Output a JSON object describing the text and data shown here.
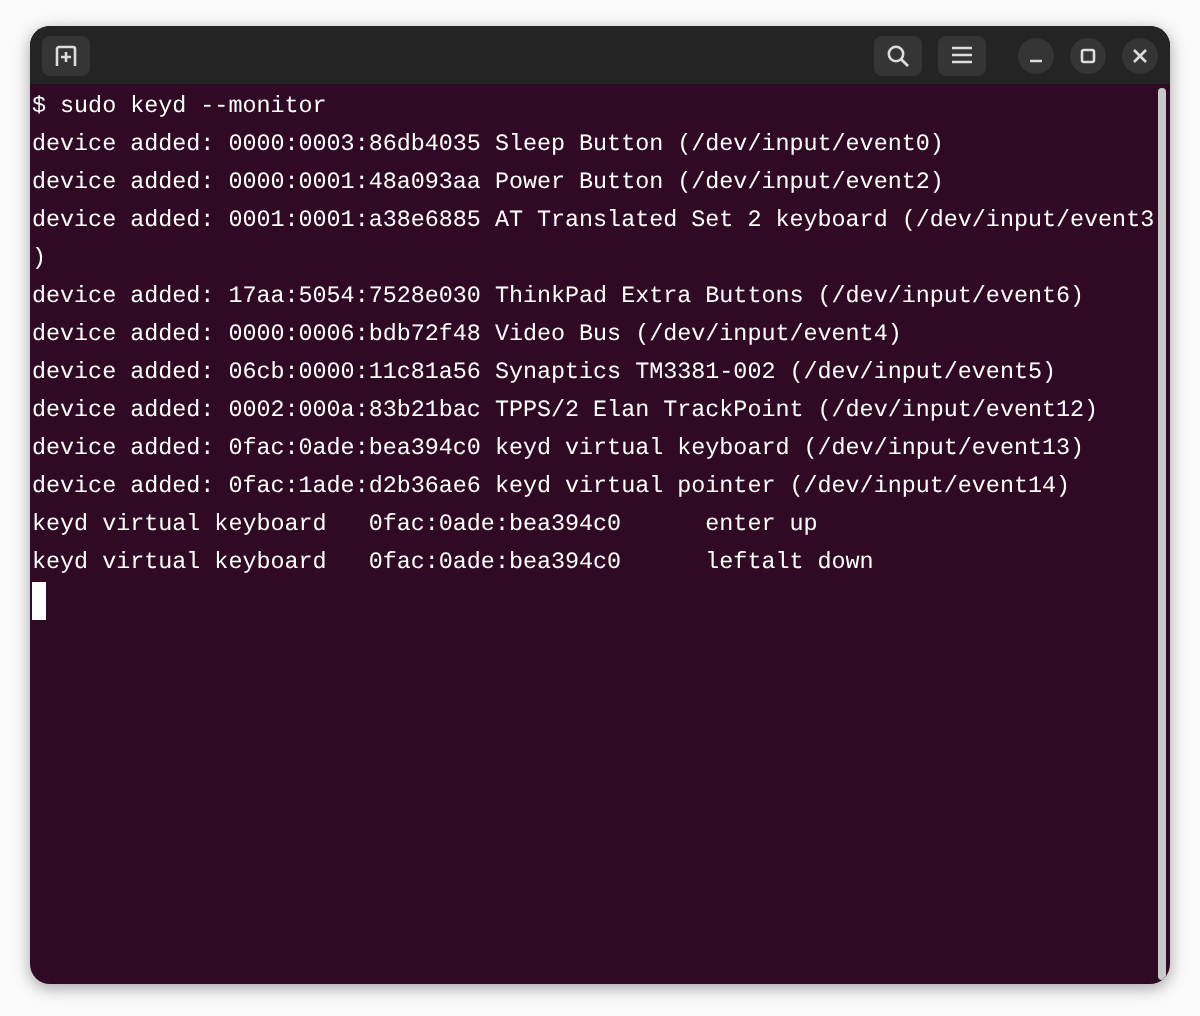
{
  "terminal": {
    "lines": [
      "$ sudo keyd --monitor",
      "device added: 0000:0003:86db4035 Sleep Button (/dev/input/event0)",
      "device added: 0000:0001:48a093aa Power Button (/dev/input/event2)",
      "device added: 0001:0001:a38e6885 AT Translated Set 2 keyboard (/dev/input/event3",
      ")",
      "device added: 17aa:5054:7528e030 ThinkPad Extra Buttons (/dev/input/event6)",
      "device added: 0000:0006:bdb72f48 Video Bus (/dev/input/event4)",
      "device added: 06cb:0000:11c81a56 Synaptics TM3381-002 (/dev/input/event5)",
      "device added: 0002:000a:83b21bac TPPS/2 Elan TrackPoint (/dev/input/event12)",
      "device added: 0fac:0ade:bea394c0 keyd virtual keyboard (/dev/input/event13)",
      "device added: 0fac:1ade:d2b36ae6 keyd virtual pointer (/dev/input/event14)",
      "keyd virtual keyboard   0fac:0ade:bea394c0      enter up",
      "keyd virtual keyboard   0fac:0ade:bea394c0      leftalt down"
    ],
    "cursor_visible": true
  }
}
